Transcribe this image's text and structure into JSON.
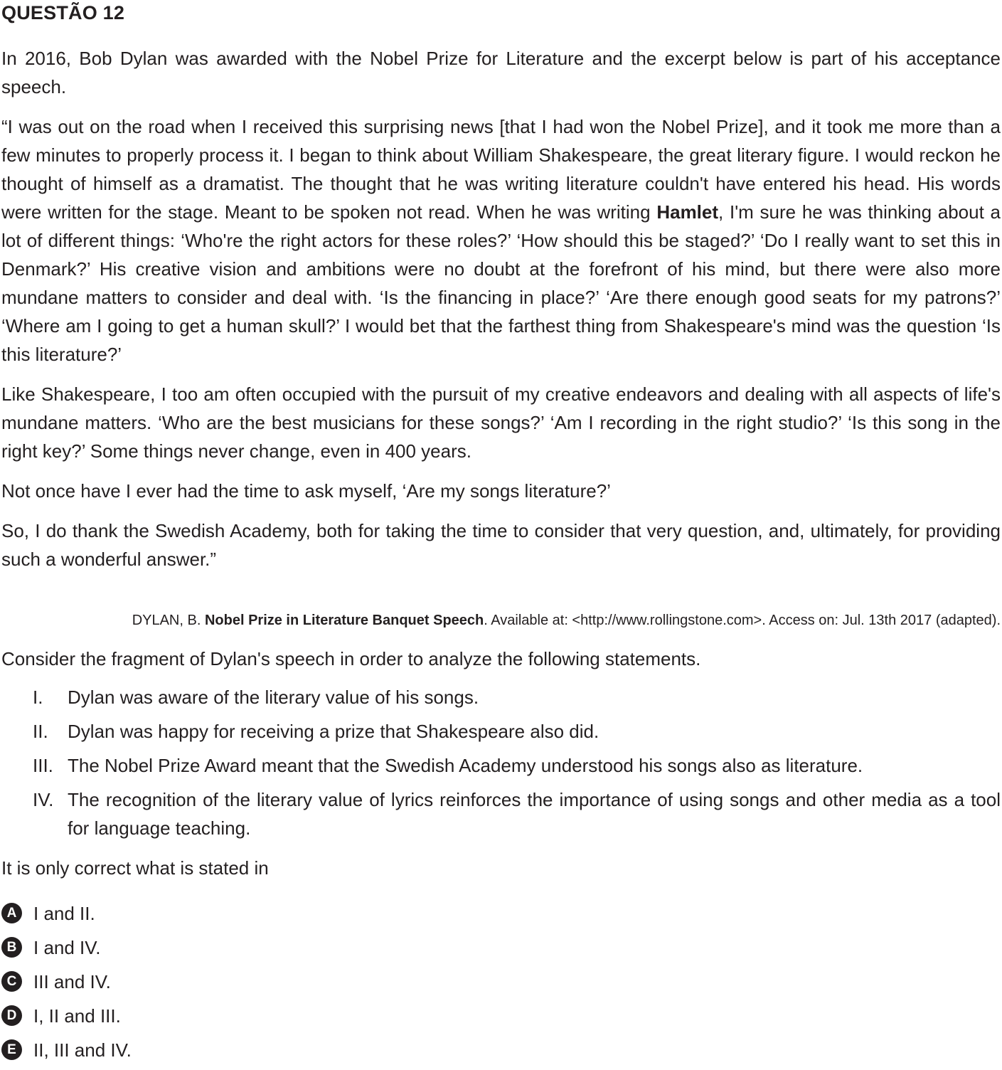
{
  "heading": "QUESTÃO 12",
  "intro": "In 2016, Bob Dylan was awarded with the Nobel Prize for Literature and the excerpt below is part of his acceptance speech.",
  "quote": {
    "p1_before_bold": "“I was out on the road when I received this surprising news [that I had won the Nobel Prize], and it took me more than a few minutes to properly process it. I began to think about William Shakespeare, the great literary figure. I would reckon he thought of himself as a dramatist. The thought that he was writing literature couldn't have entered his head. His words were written for the stage. Meant to be spoken not read. When he was writing ",
    "p1_bold": "Hamlet",
    "p1_after_bold": ", I'm sure he was thinking about a lot of different things: ‘Who're the right actors for these roles?’ ‘How should this be staged?’ ‘Do I really want to set this in Denmark?’ His creative vision and ambitions were no doubt at the forefront of his mind, but there were also more mundane matters to consider and deal with. ‘Is the financing in place?’ ‘Are there enough good seats for my patrons?’ ‘Where am I going to get a human skull?’ I would bet that the farthest thing from Shakespeare's mind was the question ‘Is this literature?’",
    "p2": "Like Shakespeare, I too am often occupied with the pursuit of my creative endeavors and dealing with all aspects of life's mundane matters. ‘Who are the best musicians for these songs?’ ‘Am I recording in the right studio?’ ‘Is this song in the right key?’ Some things never change, even in 400 years.",
    "p3": "Not once have I ever had the time to ask myself, ‘Are my songs literature?’",
    "p4": "So, I do thank the Swedish Academy, both for taking the time to consider that very question, and, ultimately, for providing such a wonderful answer.”"
  },
  "source": {
    "author": "DYLAN, B. ",
    "title": "Nobel Prize in Literature Banquet Speech",
    "rest": ". Available at: <http://www.rollingstone.com>. Access on: Jul. 13th 2017 (adapted)."
  },
  "prompt": "Consider the fragment of Dylan's speech in order to analyze the following statements.",
  "statements": [
    {
      "num": "I.",
      "text": "Dylan was aware of the literary value of his songs."
    },
    {
      "num": "II.",
      "text": "Dylan was happy for receiving a prize that Shakespeare also did."
    },
    {
      "num": "III.",
      "text": "The Nobel Prize Award meant that the Swedish Academy understood his songs also as literature."
    },
    {
      "num": "IV.",
      "text": "The recognition of the literary value of lyrics reinforces the importance of using songs and other media as a tool for language teaching."
    }
  ],
  "lead": "It is only correct what is stated in",
  "options": [
    {
      "letter": "A",
      "text": "I and II."
    },
    {
      "letter": "B",
      "text": "I and IV."
    },
    {
      "letter": "C",
      "text": "III and IV."
    },
    {
      "letter": "D",
      "text": "I, II and III."
    },
    {
      "letter": "E",
      "text": "II, III and IV."
    }
  ]
}
